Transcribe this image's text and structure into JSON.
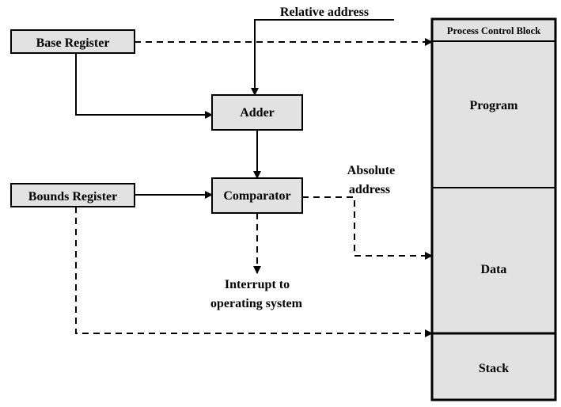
{
  "labels": {
    "relative_address": "Relative address",
    "absolute_address_line1": "Absolute",
    "absolute_address_line2": "address",
    "interrupt_line1": "Interrupt to",
    "interrupt_line2": "operating system"
  },
  "boxes": {
    "base_register": "Base Register",
    "bounds_register": "Bounds Register",
    "adder": "Adder",
    "comparator": "Comparator"
  },
  "process_image": {
    "segments": [
      "Process Control Block",
      "Program",
      "Data",
      "Stack"
    ]
  },
  "colors": {
    "box_fill": "#e2e2e2",
    "line": "#000000"
  }
}
